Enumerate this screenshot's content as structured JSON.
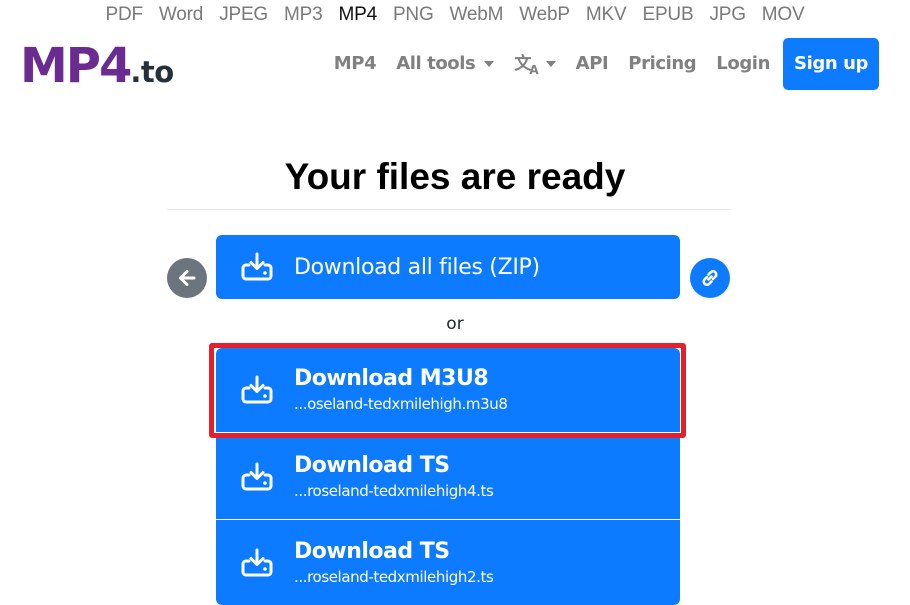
{
  "format_bar": {
    "items": [
      {
        "label": "PDF",
        "active": false
      },
      {
        "label": "Word",
        "active": false
      },
      {
        "label": "JPEG",
        "active": false
      },
      {
        "label": "MP3",
        "active": false
      },
      {
        "label": "MP4",
        "active": true
      },
      {
        "label": "PNG",
        "active": false
      },
      {
        "label": "WebM",
        "active": false
      },
      {
        "label": "WebP",
        "active": false
      },
      {
        "label": "MKV",
        "active": false
      },
      {
        "label": "EPUB",
        "active": false
      },
      {
        "label": "JPG",
        "active": false
      },
      {
        "label": "MOV",
        "active": false
      }
    ]
  },
  "header": {
    "logo_main": "MP4",
    "logo_tld": ".to",
    "nav": {
      "mp4": "MP4",
      "all_tools": "All tools",
      "lang_icon": "translate-icon",
      "api": "API",
      "pricing": "Pricing",
      "login": "Login",
      "signup": "Sign up"
    }
  },
  "main": {
    "title": "Your files are ready",
    "download_all_label": "Download all files (ZIP)",
    "or_label": "or",
    "back_icon": "arrow-left-icon",
    "link_icon": "link-icon",
    "files": [
      {
        "title": "Download M3U8",
        "filename": "...oseland-tedxmilehigh.m3u8",
        "highlighted": true
      },
      {
        "title": "Download TS",
        "filename": "...roseland-tedxmilehigh4.ts",
        "highlighted": false
      },
      {
        "title": "Download TS",
        "filename": "...roseland-tedxmilehigh2.ts",
        "highlighted": false
      }
    ]
  },
  "colors": {
    "brand_purple": "#6a2c91",
    "primary_blue": "#0d7bff",
    "highlight_red": "#e3202c",
    "secondary_gray": "#6c757d"
  }
}
